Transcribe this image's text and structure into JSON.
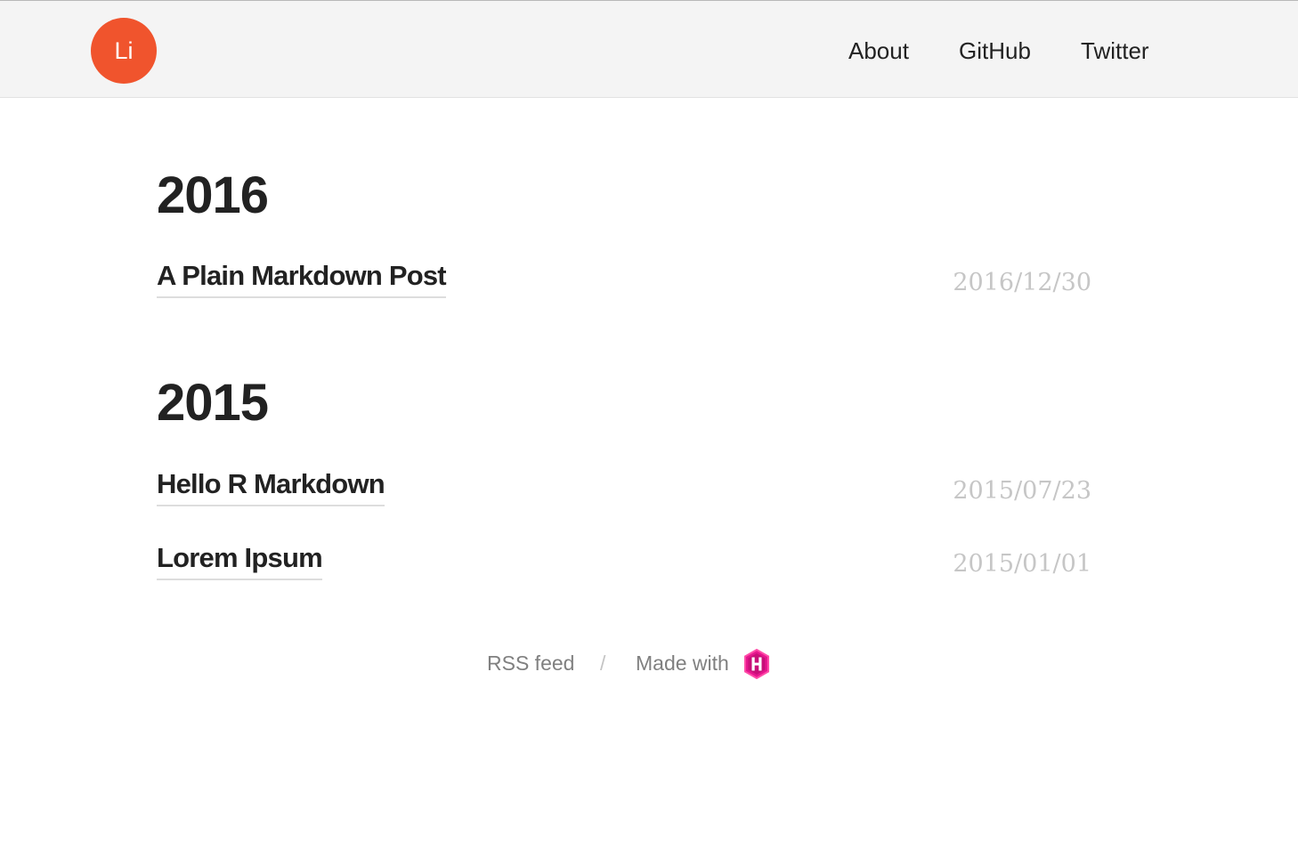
{
  "header": {
    "logo_text": "Li",
    "nav": [
      {
        "label": "About"
      },
      {
        "label": "GitHub"
      },
      {
        "label": "Twitter"
      }
    ]
  },
  "archive": [
    {
      "year": "2016",
      "posts": [
        {
          "title": "A Plain Markdown Post",
          "date": "2016/12/30"
        }
      ]
    },
    {
      "year": "2015",
      "posts": [
        {
          "title": "Hello R Markdown",
          "date": "2015/07/23"
        },
        {
          "title": "Lorem Ipsum",
          "date": "2015/01/01"
        }
      ]
    }
  ],
  "footer": {
    "rss_label": "RSS feed",
    "separator": "/",
    "made_with_label": "Made with",
    "made_with_icon": "hugo-logo-icon"
  },
  "colors": {
    "logo_bg": "#f0542d",
    "header_bg": "#f4f4f4",
    "date_text": "#c6c6c6",
    "hugo_icon": "#e6168e"
  }
}
